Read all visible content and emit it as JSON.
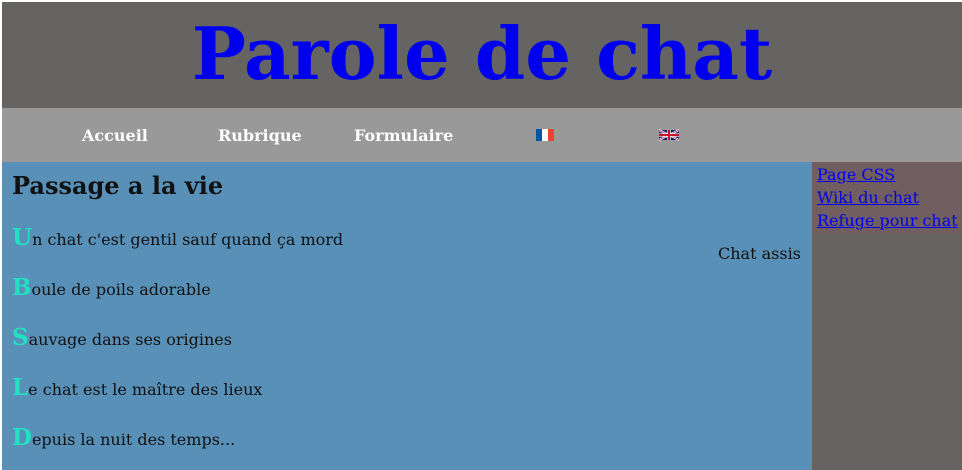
{
  "header": {
    "title": "Parole de chat"
  },
  "nav": {
    "items": [
      {
        "label": "Accueil"
      },
      {
        "label": "Rubrique"
      },
      {
        "label": "Formulaire"
      }
    ],
    "languages": [
      {
        "icon": "flag-fr-icon"
      },
      {
        "icon": "flag-uk-icon"
      }
    ]
  },
  "main": {
    "heading": "Passage a la vie",
    "lines": [
      {
        "initial": "U",
        "rest": "n chat c'est gentil sauf quand ça mord"
      },
      {
        "initial": "B",
        "rest": "oule de poils adorable"
      },
      {
        "initial": "S",
        "rest": "auvage dans ses origines"
      },
      {
        "initial": "L",
        "rest": "e chat est le maître des lieux"
      },
      {
        "initial": "D",
        "rest": "epuis la nuit des temps..."
      }
    ],
    "image_caption": "Chat assis"
  },
  "sidebar": {
    "links": [
      {
        "label": "Page CSS"
      },
      {
        "label": "Wiki du chat"
      },
      {
        "label": "Refuge pour chat"
      }
    ]
  },
  "colors": {
    "header_bg": "#666462",
    "title": "#0000ee",
    "nav_bg": "#999999",
    "main_bg": "#5890b8",
    "initial": "#22e0c2",
    "sidebar_links_bg": "#705e60"
  }
}
